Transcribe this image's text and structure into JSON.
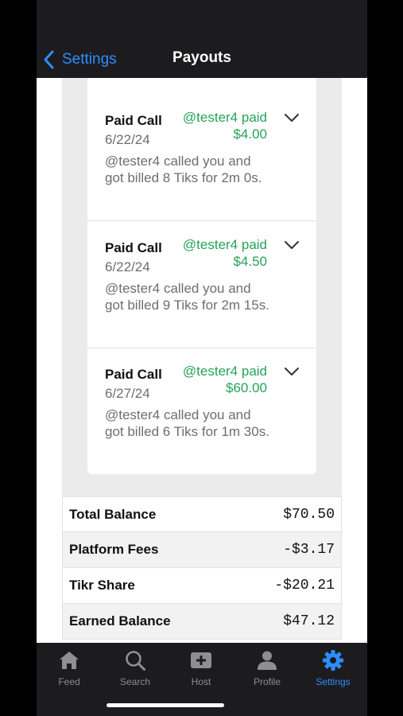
{
  "nav": {
    "back_label": "Settings",
    "title": "Payouts"
  },
  "payouts": [
    {
      "title": "Paid Call",
      "date": "6/22/24",
      "paid_line1": "@tester4 paid",
      "paid_amount": "$4.00",
      "description": "@tester4 called you and got billed 8 Tiks for 2m 0s."
    },
    {
      "title": "Paid Call",
      "date": "6/22/24",
      "paid_line1": "@tester4 paid",
      "paid_amount": "$4.50",
      "description": "@tester4 called you and got billed 9 Tiks for 2m 15s."
    },
    {
      "title": "Paid Call",
      "date": "6/27/24",
      "paid_line1": "@tester4 paid",
      "paid_amount": "$60.00",
      "description": "@tester4 called you and got billed 6 Tiks for 1m 30s."
    }
  ],
  "totals": [
    {
      "label": "Total Balance",
      "value": "$70.50"
    },
    {
      "label": "Platform Fees",
      "value": "-$3.17"
    },
    {
      "label": "Tikr Share",
      "value": "-$20.21"
    },
    {
      "label": "Earned Balance",
      "value": "$47.12"
    }
  ],
  "tabs": [
    {
      "label": "Feed",
      "icon": "house-icon"
    },
    {
      "label": "Search",
      "icon": "magnifier-icon"
    },
    {
      "label": "Host",
      "icon": "plus-square-icon"
    },
    {
      "label": "Profile",
      "icon": "person-icon"
    },
    {
      "label": "Settings",
      "icon": "gear-icon",
      "active": true
    }
  ],
  "colors": {
    "accent": "#2f8cff",
    "paid_green": "#26a259",
    "bar_bg": "#1c1c1e"
  }
}
